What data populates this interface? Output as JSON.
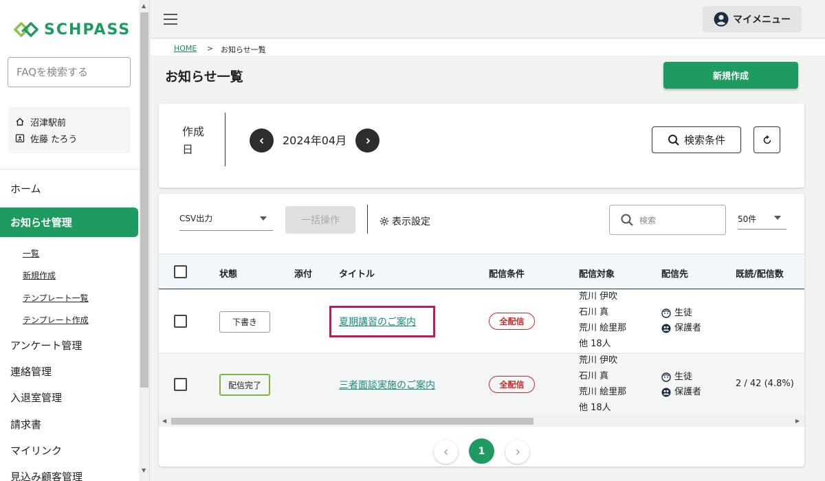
{
  "brand": {
    "name": "SCHPASS",
    "color": "#1e9b60"
  },
  "sidebar": {
    "faq_placeholder": "FAQを検索する",
    "user": {
      "school": "沼津駅前",
      "name": "佐藤 たろう"
    },
    "nav": {
      "home": "ホーム",
      "notice_mgmt": "お知らせ管理",
      "sub": [
        "一覧",
        "新規作成",
        "テンプレート一覧",
        "テンプレート作成"
      ],
      "survey": "アンケート管理",
      "contact": "連絡管理",
      "entry": "入退室管理",
      "invoice": "請求書",
      "mylink": "マイリンク",
      "prospect": "見込み顧客管理"
    }
  },
  "header": {
    "mymenu": "マイメニュー"
  },
  "breadcrumb": {
    "home": "HOME",
    "sep": ">",
    "current": "お知らせ一覧"
  },
  "page": {
    "title": "お知らせ一覧",
    "new_button": "新規作成"
  },
  "filter": {
    "date_label": "作成日",
    "month": "2024年04月",
    "search_cond": "検索条件"
  },
  "toolbar": {
    "csv": "CSV出力",
    "bulk": "一括操作",
    "display_settings": "表示設定",
    "search_placeholder": "検索",
    "per_page": "50件"
  },
  "table": {
    "headers": [
      "状態",
      "添付",
      "タイトル",
      "配信条件",
      "配信対象",
      "配信先",
      "既読/配信数"
    ],
    "rows": [
      {
        "status": "下書き",
        "title": "夏期講習のご案内",
        "condition": "全配信",
        "targets": [
          "荒川 伊吹",
          "石川 真",
          "荒川 絵里那",
          "他 18人"
        ],
        "dest": [
          "生徒",
          "保護者"
        ],
        "count": ""
      },
      {
        "status": "配信完了",
        "title": "三者面談実施のご案内",
        "condition": "全配信",
        "targets": [
          "荒川 伊吹",
          "石川 真",
          "荒川 絵里那",
          "他 18人"
        ],
        "dest": [
          "生徒",
          "保護者"
        ],
        "count": "2 / 42 (4.8%)"
      }
    ]
  },
  "pagination": {
    "current": "1"
  },
  "colors": {
    "danger": "#c62828",
    "link": "#1a8a7a",
    "highlight": "#c2185b",
    "complete": "#7cb342"
  }
}
